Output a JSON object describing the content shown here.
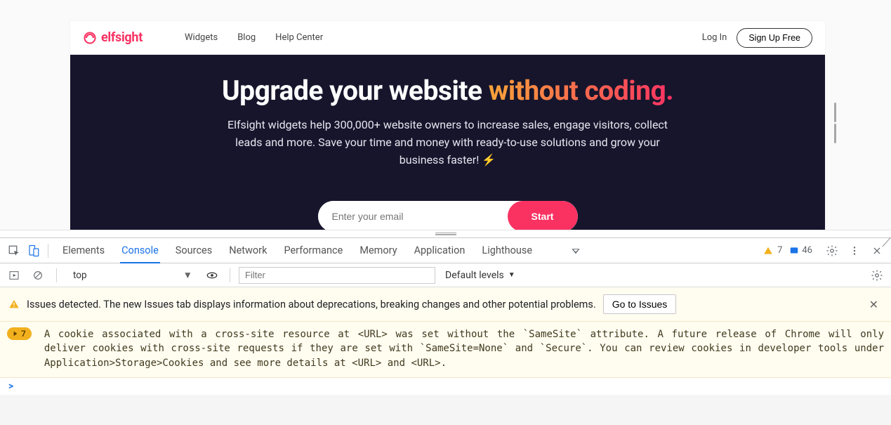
{
  "site": {
    "brand": "elfsight",
    "nav": [
      "Widgets",
      "Blog",
      "Help Center"
    ],
    "login": "Log In",
    "signup": "Sign Up Free",
    "hero_title_a": "Upgrade your website ",
    "hero_title_b": "without coding.",
    "hero_sub": "Elfsight widgets help 300,000+ website owners to increase sales, engage visitors, collect leads and more. Save your time and money with ready-to-use solutions and grow your business faster! ",
    "email_placeholder": "Enter your email",
    "start_label": "Start"
  },
  "devtools": {
    "tabs": [
      "Elements",
      "Console",
      "Sources",
      "Network",
      "Performance",
      "Memory",
      "Application",
      "Lighthouse"
    ],
    "active_tab": "Console",
    "warn_count": "7",
    "info_count": "46",
    "context": "top",
    "filter_placeholder": "Filter",
    "levels_label": "Default levels",
    "issues_text": "Issues detected. The new Issues tab displays information about deprecations, breaking changes and other potential problems.",
    "goto_issues": "Go to Issues",
    "log_badge": "7",
    "log_msg": "A cookie associated with a cross-site resource at <URL> was set without the `SameSite` attribute. A future release of Chrome will only deliver cookies with cross-site requests if they are set with `SameSite=None` and `Secure`. You can review cookies in developer tools under Application>Storage>Cookies and see more details at <URL> and <URL>.",
    "prompt": ">"
  }
}
